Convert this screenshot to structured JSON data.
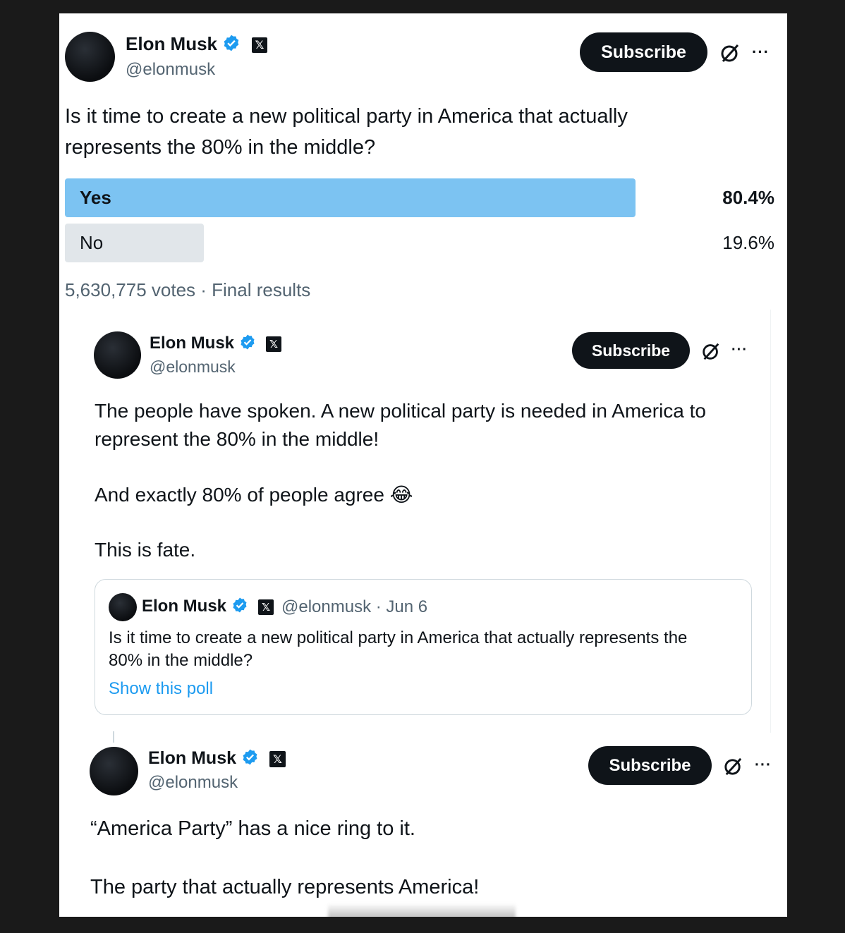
{
  "colors": {
    "poll_winner": "#7cc3f2",
    "poll_loser": "#e1e6ea",
    "link": "#1d9bf0",
    "verified": "#1d9bf0"
  },
  "post1": {
    "author": "Elon Musk",
    "handle": "@elonmusk",
    "subscribe": "Subscribe",
    "more": "···",
    "text_line1": "Is it time to create a new political party in America that actually",
    "text_line2": "represents the 80% in the middle?",
    "poll": {
      "options": [
        {
          "label": "Yes",
          "percent": "80.4%",
          "value": 80.4
        },
        {
          "label": "No",
          "percent": "19.6%",
          "value": 19.6
        }
      ],
      "summary": "5,630,775 votes · Final results"
    }
  },
  "post2": {
    "author": "Elon Musk",
    "handle": "@elonmusk",
    "subscribe": "Subscribe",
    "more": "···",
    "line1": "The people have spoken. A new political party is needed in America to",
    "line2": "represent the 80% in the middle!",
    "line3": "And exactly 80% of people agree",
    "emoji": "😂",
    "line4": "This is fate.",
    "quote": {
      "author": "Elon Musk",
      "meta": "@elonmusk · Jun 6",
      "line1": "Is it time to create a new political party in America that actually represents the",
      "line2": "80% in the middle?",
      "link": "Show this poll"
    }
  },
  "post3": {
    "author": "Elon Musk",
    "handle": "@elonmusk",
    "subscribe": "Subscribe",
    "more": "···",
    "line1": "“America Party” has a nice ring to it.",
    "line2": "The party that actually represents America!"
  }
}
